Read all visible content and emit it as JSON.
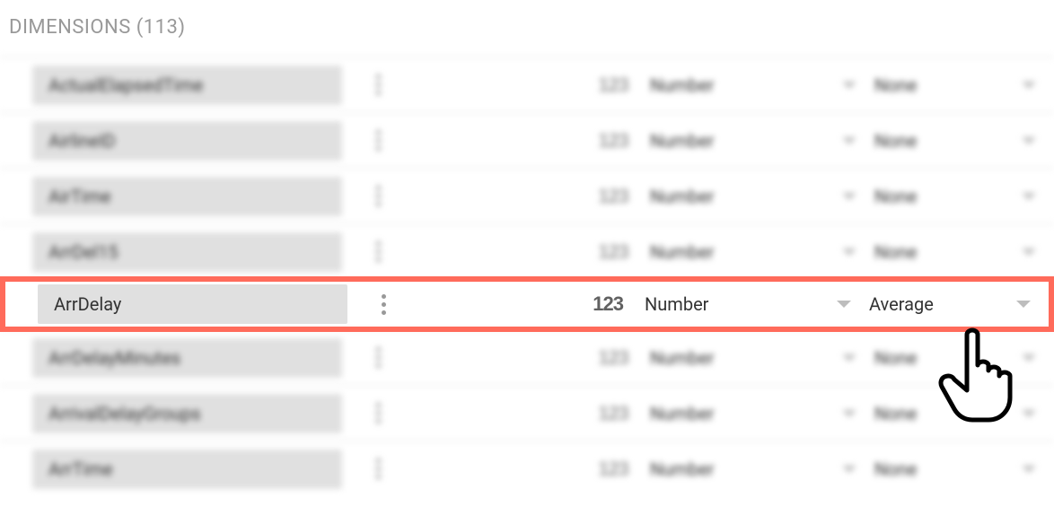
{
  "section": {
    "title": "DIMENSIONS (113)"
  },
  "rows": [
    {
      "field": "ActualElapsedTime",
      "type_icon": "123",
      "type": "Number",
      "aggregation": "None",
      "blurred": true,
      "highlighted": false
    },
    {
      "field": "AirlineID",
      "type_icon": "123",
      "type": "Number",
      "aggregation": "None",
      "blurred": true,
      "highlighted": false
    },
    {
      "field": "AirTime",
      "type_icon": "123",
      "type": "Number",
      "aggregation": "None",
      "blurred": true,
      "highlighted": false
    },
    {
      "field": "ArrDel15",
      "type_icon": "123",
      "type": "Number",
      "aggregation": "None",
      "blurred": true,
      "highlighted": false
    },
    {
      "field": "ArrDelay",
      "type_icon": "123",
      "type": "Number",
      "aggregation": "Average",
      "blurred": false,
      "highlighted": true
    },
    {
      "field": "ArrDelayMinutes",
      "type_icon": "123",
      "type": "Number",
      "aggregation": "None",
      "blurred": true,
      "highlighted": false
    },
    {
      "field": "ArrivalDelayGroups",
      "type_icon": "123",
      "type": "Number",
      "aggregation": "None",
      "blurred": true,
      "highlighted": false
    },
    {
      "field": "ArrTime",
      "type_icon": "123",
      "type": "Number",
      "aggregation": "None",
      "blurred": true,
      "highlighted": false
    }
  ]
}
